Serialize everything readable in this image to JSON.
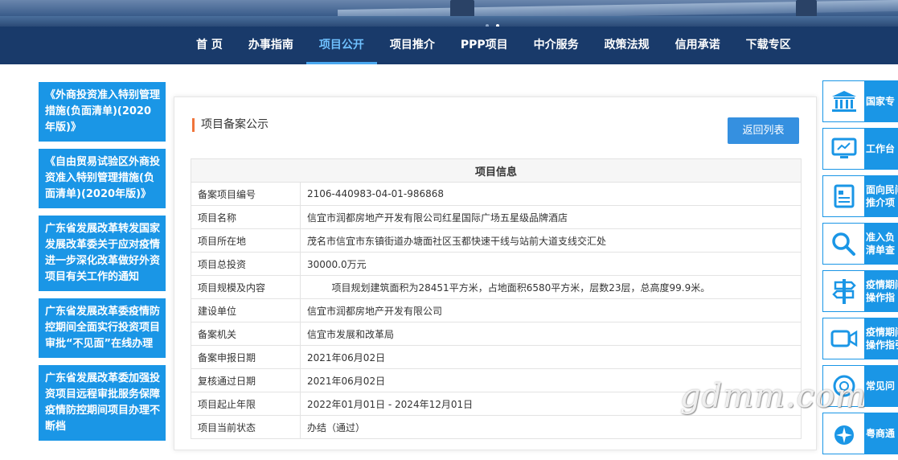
{
  "nav": {
    "items": [
      "首 页",
      "办事指南",
      "项目公开",
      "项目推介",
      "PPP项目",
      "中介服务",
      "政策法规",
      "信用承诺",
      "下载专区"
    ],
    "active_index": 2
  },
  "carousel": {
    "dot_count": 2,
    "active_dot": 1
  },
  "left_links": [
    "《外商投资准入特别管理措施(负面清单)(2020年版)》",
    "《自由贸易试验区外商投资准入特别管理措施(负面清单)(2020年版)》",
    "广东省发展改革转发国家发展改革委关于应对疫情进一步深化改革做好外资项目有关工作的通知",
    "广东省发展改革委疫情防控期间全面实行投资项目审批“不见面”在线办理",
    "广东省发展改革委加强投资项目远程审批服务保障疫情防控期间项目办理不断档"
  ],
  "main": {
    "section_title": "项目备案公示",
    "back_button": "返回列表",
    "table_header": "项目信息",
    "rows": [
      {
        "key": "备案项目编号",
        "value": "2106-440983-04-01-986868"
      },
      {
        "key": "项目名称",
        "value": "信宜市润都房地产开发有限公司红星国际广场五星级品牌酒店"
      },
      {
        "key": "项目所在地",
        "value": "茂名市信宜市东镇街道办塘面社区玉都快速干线与站前大道支线交汇处"
      },
      {
        "key": "项目总投资",
        "value": "30000.0万元"
      },
      {
        "key": "项目规模及内容",
        "value": "        项目规划建筑面积为28451平方米，占地面积6580平方米，层数23层，总高度99.9米。"
      },
      {
        "key": "建设单位",
        "value": "信宜市润都房地产开发有限公司"
      },
      {
        "key": "备案机关",
        "value": "信宜市发展和改革局"
      },
      {
        "key": "备案申报日期",
        "value": "2021年06月02日"
      },
      {
        "key": "复核通过日期",
        "value": "2021年06月02日"
      },
      {
        "key": "项目起止年限",
        "value": "2022年01月01日 - 2024年12月01日"
      },
      {
        "key": "项目当前状态",
        "value": "办结（通过）"
      }
    ]
  },
  "right_links": [
    {
      "text": "国家专",
      "icon": "government-building-icon"
    },
    {
      "text": "工作台",
      "icon": "computer-screen-icon"
    },
    {
      "text": "面向民间\n推介项",
      "icon": "document-list-icon"
    },
    {
      "text": "准入负\n清单查",
      "icon": "magnifier-icon"
    },
    {
      "text": "疫情期间\n操作指",
      "icon": "signpost-icon"
    },
    {
      "text": "疫情期间\n操作指引",
      "icon": "video-camera-icon"
    },
    {
      "text": "常见问",
      "icon": "question-bubble-icon"
    },
    {
      "text": "粤商通",
      "icon": "yueshangtong-logo-icon"
    }
  ],
  "watermark": "gdmm.com",
  "colors": {
    "nav_bg": "#193a6a",
    "nav_active": "#6fc1ff",
    "card_blue": "#1a96e6",
    "button_blue": "#3590e0",
    "title_accent": "#f0743a"
  }
}
